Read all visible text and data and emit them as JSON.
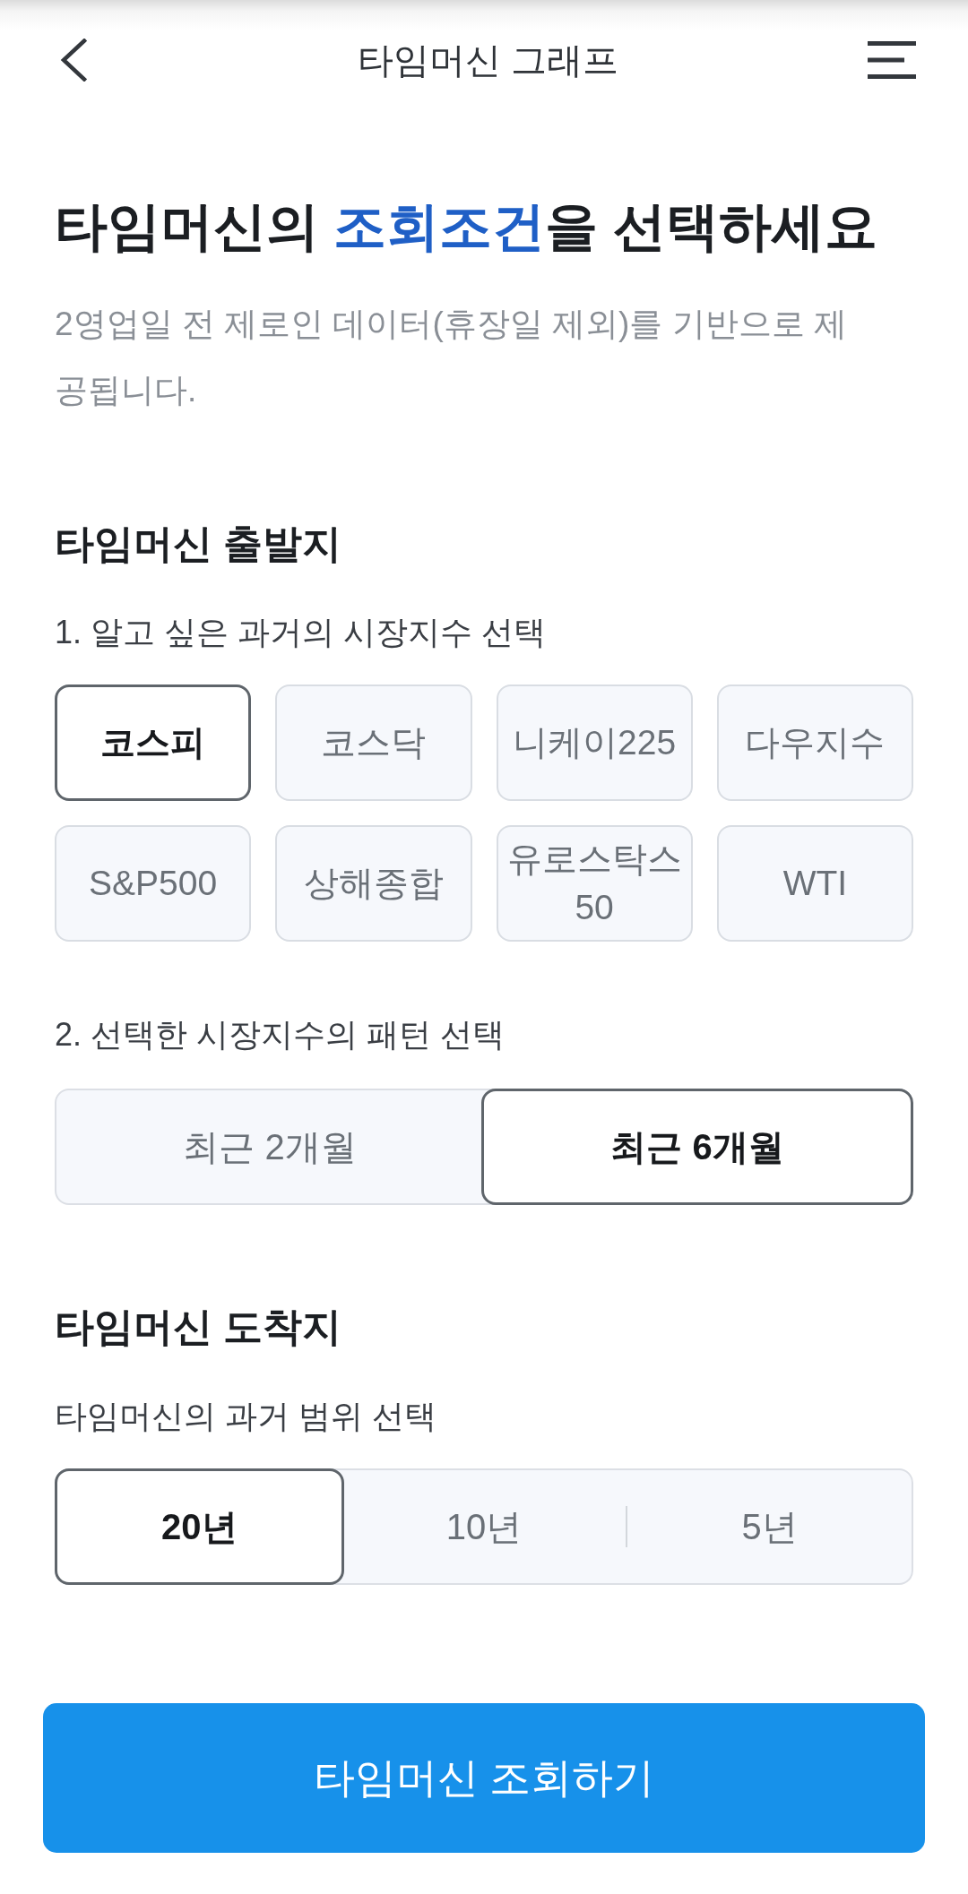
{
  "header": {
    "title": "타임머신 그래프"
  },
  "heading": {
    "parts": [
      {
        "text": "타임머신의 ",
        "kind": "plain"
      },
      {
        "text": "조회조건",
        "kind": "accent"
      },
      {
        "text": "을 선택하세요",
        "kind": "plain"
      }
    ]
  },
  "description": "2영업일 전 제로인 데이터(휴장일 제외)를 기반으로 제공됩니다.",
  "departure": {
    "title": "타임머신 출발지",
    "index_label": "1. 알고 싶은 과거의 시장지수 선택",
    "indices": [
      {
        "label": "코스피",
        "selected": true
      },
      {
        "label": "코스닥",
        "selected": false
      },
      {
        "label": "니케이225",
        "selected": false
      },
      {
        "label": "다우지수",
        "selected": false
      },
      {
        "label": "S&P500",
        "selected": false
      },
      {
        "label": "상해종합",
        "selected": false
      },
      {
        "label": "유로스탁스50",
        "selected": false
      },
      {
        "label": "WTI",
        "selected": false
      }
    ],
    "pattern_label": "2. 선택한 시장지수의 패턴 선택",
    "patterns": [
      {
        "label": "최근 2개월",
        "selected": false
      },
      {
        "label": "최근 6개월",
        "selected": true
      }
    ]
  },
  "arrival": {
    "title": "타임머신 도착지",
    "range_label": "타임머신의 과거 범위 선택",
    "ranges": [
      {
        "label": "20년",
        "selected": true
      },
      {
        "label": "10년",
        "selected": false
      },
      {
        "label": "5년",
        "selected": false
      }
    ]
  },
  "submit_button": "타임머신 조회하기"
}
